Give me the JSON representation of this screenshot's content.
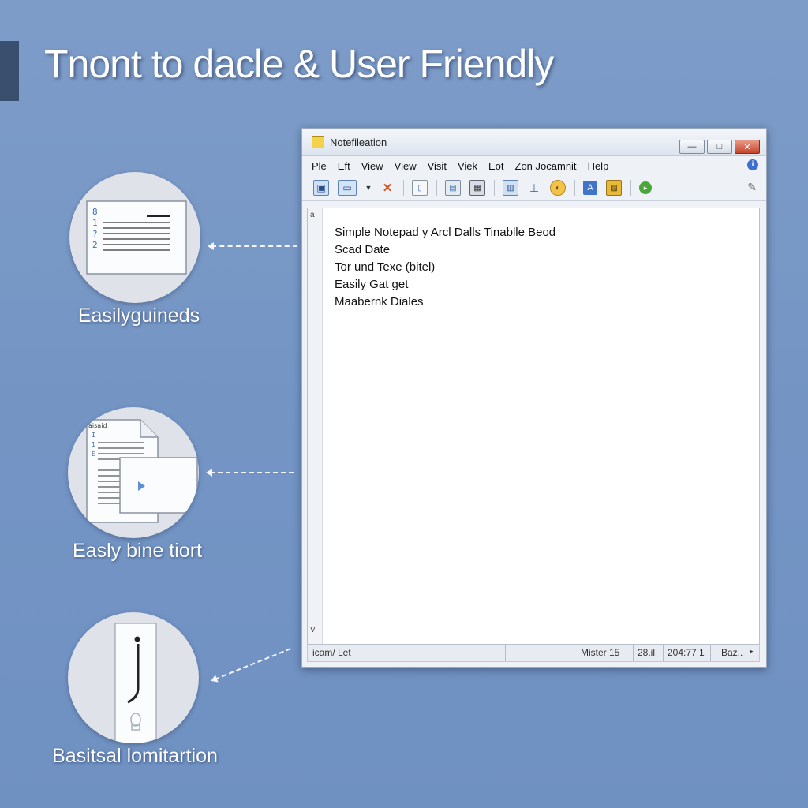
{
  "headline": "Tnont to dacle & User Friendly",
  "features": [
    {
      "caption": "Easilyguineds"
    },
    {
      "caption": "Easly bine tiort"
    },
    {
      "caption": "Basitsal lomitartion"
    }
  ],
  "window": {
    "title": "Notefileation",
    "controls": {
      "minimize": "—",
      "maximize": "□",
      "close": "✕"
    },
    "menu": [
      "Ple",
      "Eft",
      "View",
      "View",
      "Visit",
      "Viek",
      "Eot",
      "Zon Jocamnit",
      "Help"
    ],
    "editor_lines": [
      "Simple Notepad y Arcl Dalls Tinablle Beod",
      "Scad Date",
      "Tor und Texe (bitel)",
      "Easily Gat get",
      "Maabernk Diales"
    ],
    "scroll_up": "a",
    "scroll_down": "V",
    "status": {
      "left": "icam/ Let",
      "position": "Mister 15",
      "col": "28.il",
      "count": "204:77 1",
      "encoding": "Baz.."
    }
  },
  "icons": {
    "toolbar": [
      "new-icon",
      "open-icon",
      "cut-icon",
      "copy-icon",
      "paste-icon",
      "calc-icon",
      "print-icon",
      "find-icon",
      "bold-icon",
      "format-icon",
      "image-icon",
      "go-icon"
    ],
    "feature_icons": [
      "document-lines-icon",
      "documents-play-icon",
      "cursor-icon"
    ]
  },
  "colors": {
    "background": "#7495c4",
    "accent_bar": "#3a4f6e",
    "close_button": "#c4452c"
  }
}
